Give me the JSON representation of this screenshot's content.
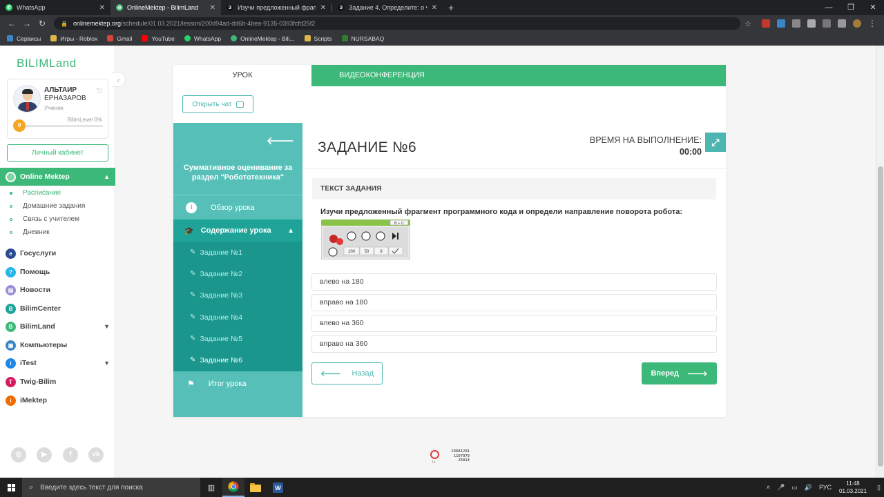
{
  "browser": {
    "tabs": [
      {
        "title": "WhatsApp",
        "icon": "whatsapp-icon",
        "color": "#25d366",
        "active": false
      },
      {
        "title": "OnlineMektep - BilimLand",
        "icon": "onlinemektep-icon",
        "color": "#3cb878",
        "active": true
      },
      {
        "title": "Изучи предложенный фрагмен",
        "icon": "znanija-icon",
        "color": "#111111",
        "active": false
      },
      {
        "title": "Задание 4. Определите: о чем и",
        "icon": "znanija-icon",
        "color": "#111111",
        "active": false
      }
    ],
    "url_host": "onlinemektep.org",
    "url_path": "/schedule/01.03.2021/lesson/200d94ad-dd6b-4bea-9135-0393fcfd25f2",
    "bookmarks": [
      "Сервисы",
      "Игры - Roblox",
      "Gmail",
      "YouTube",
      "WhatsApp",
      "OnlineMektep - Bili...",
      "Scripts",
      "NURSABAQ"
    ]
  },
  "sidebar": {
    "logo": "BILIMLand",
    "profile": {
      "first_name": "АЛЬТАИР",
      "last_name": "ЕРНАЗАРОВ",
      "role": "Ученик",
      "level_label": "BilimLevel 0%",
      "level": "0",
      "level_fraction": 0
    },
    "cabinet_button": "Личный кабинет",
    "online_mektep": "Online Mektep",
    "subitems": [
      "Расписание",
      "Домашние задания",
      "Связь с учителем",
      "Дневник"
    ],
    "items": [
      {
        "label": "Госуслуги",
        "color": "#2c4a8f",
        "icon": "gov-icon",
        "chevron": false
      },
      {
        "label": "Помощь",
        "color": "#29b6e8",
        "icon": "help-icon",
        "chevron": false
      },
      {
        "label": "Новости",
        "color": "#9b8fd8",
        "icon": "news-icon",
        "chevron": false
      },
      {
        "label": "BilimCenter",
        "color": "#1fa399",
        "icon": "bilimcenter-icon",
        "chevron": false
      },
      {
        "label": "BilimLand",
        "color": "#3cb878",
        "icon": "bilimland-icon",
        "chevron": true
      },
      {
        "label": "Компьютеры",
        "color": "#3b86c6",
        "icon": "computers-icon",
        "chevron": false
      },
      {
        "label": "iTest",
        "color": "#1e88e5",
        "icon": "itest-icon",
        "chevron": true
      },
      {
        "label": "Twig-Bilim",
        "color": "#d81b60",
        "icon": "twig-icon",
        "chevron": false
      },
      {
        "label": "iMektep",
        "color": "#ef6c00",
        "icon": "imektep-icon",
        "chevron": false
      }
    ]
  },
  "lesson": {
    "tab_lesson": "УРОК",
    "tab_video": "ВИДЕОКОНФЕРЕНЦИЯ",
    "open_chat": "Открыть чат",
    "section_title": "Суммативное оценивание за раздел \"Робототехника\"",
    "overview": "Обзор урока",
    "content": "Содержание урока",
    "tasks": [
      "Задание №1",
      "Задание №2",
      "Задание №3",
      "Задание №4",
      "Задание №5",
      "Задание №6"
    ],
    "summary": "Итог урока"
  },
  "task": {
    "title": "ЗАДАНИЕ №6",
    "time_label": "ВРЕМЯ НА ВЫПОЛНЕНИЕ:",
    "time_value": "00:00",
    "text_header": "ТЕКСТ ЗАДАНИЯ",
    "question": "Изучи предложенный фрагмент программного кода и определи направление поворота робота:",
    "code_block": {
      "ports": "B + C",
      "values": [
        "100",
        "50",
        "8"
      ]
    },
    "answers": [
      "влево на 180",
      "вправо на 180",
      "влево на 360",
      "вправо на 360"
    ],
    "back": "Назад",
    "next": "Вперед"
  },
  "counter": {
    "lines": [
      "23681291",
      "1107979",
      "25814"
    ],
    "small": "1k"
  },
  "taskbar": {
    "search_placeholder": "Введите здесь текст для поиска",
    "lang": "РУС",
    "time": "11:48",
    "date": "01.03.2021"
  }
}
